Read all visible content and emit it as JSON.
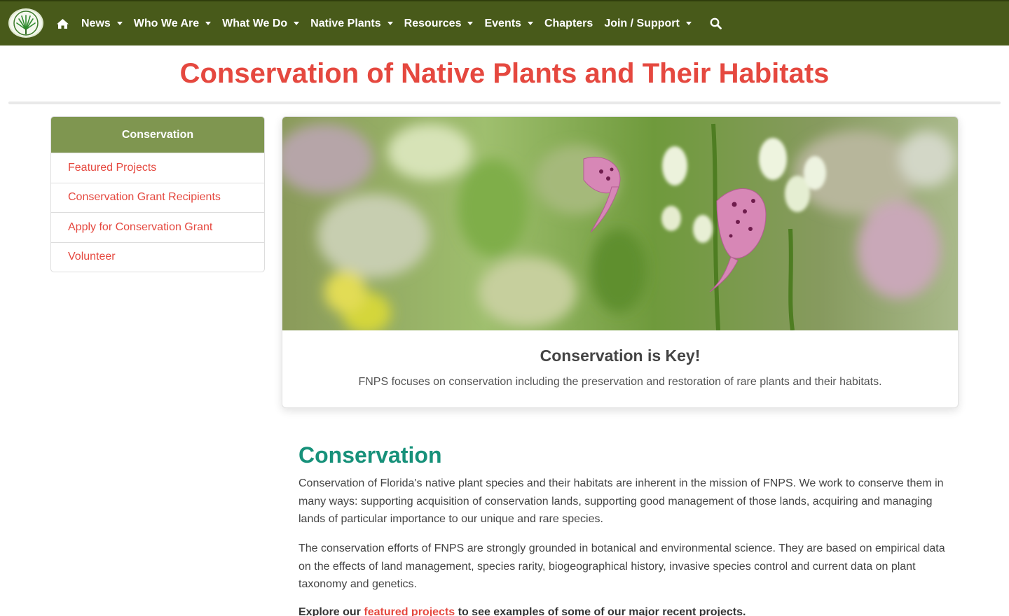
{
  "nav": {
    "logo_alt": "NATIVE PLANT SOCIETY",
    "items": [
      {
        "label": "News",
        "dropdown": true
      },
      {
        "label": "Who We Are",
        "dropdown": true
      },
      {
        "label": "What We Do",
        "dropdown": true
      },
      {
        "label": "Native Plants",
        "dropdown": true
      },
      {
        "label": "Resources",
        "dropdown": true
      },
      {
        "label": "Events",
        "dropdown": true
      },
      {
        "label": "Chapters",
        "dropdown": false
      },
      {
        "label": "Join / Support",
        "dropdown": true
      }
    ],
    "home_icon": "home-icon",
    "search_icon": "search-icon"
  },
  "header": {
    "title": "Conservation of Native Plants and Their Habitats"
  },
  "sidebar": {
    "heading": "Conservation",
    "items": [
      {
        "label": "Featured Projects"
      },
      {
        "label": "Conservation Grant Recipients"
      },
      {
        "label": "Apply for Conservation Grant"
      },
      {
        "label": "Volunteer"
      }
    ]
  },
  "hero": {
    "title": "Conservation is Key!",
    "text": "FNPS focuses on conservation including the preservation and restoration of rare plants and their habitats."
  },
  "content": {
    "heading": "Conservation",
    "paragraph1": "Conservation of Florida's native plant species and their habitats are inherent in the mission of FNPS.  We work to conserve them in many ways:  supporting acquisition of conservation lands, supporting good management of those lands, acquiring and managing lands of particular importance to our unique and rare species.",
    "paragraph2": "The conservation efforts of FNPS are strongly grounded in botanical and environmental science.  They are based on empirical data on the effects of land management, species rarity, biogeographical history, invasive species control and current data on plant taxonomy and genetics.",
    "paragraph3_prefix": "Explore our ",
    "paragraph3_link": "featured projects",
    "paragraph3_suffix": " to see examples of some of our major recent projects."
  },
  "colors": {
    "nav_bg": "#485a1a",
    "accent_red": "#e5483f",
    "sidebar_head": "#7f9650",
    "heading_teal": "#17917a"
  }
}
